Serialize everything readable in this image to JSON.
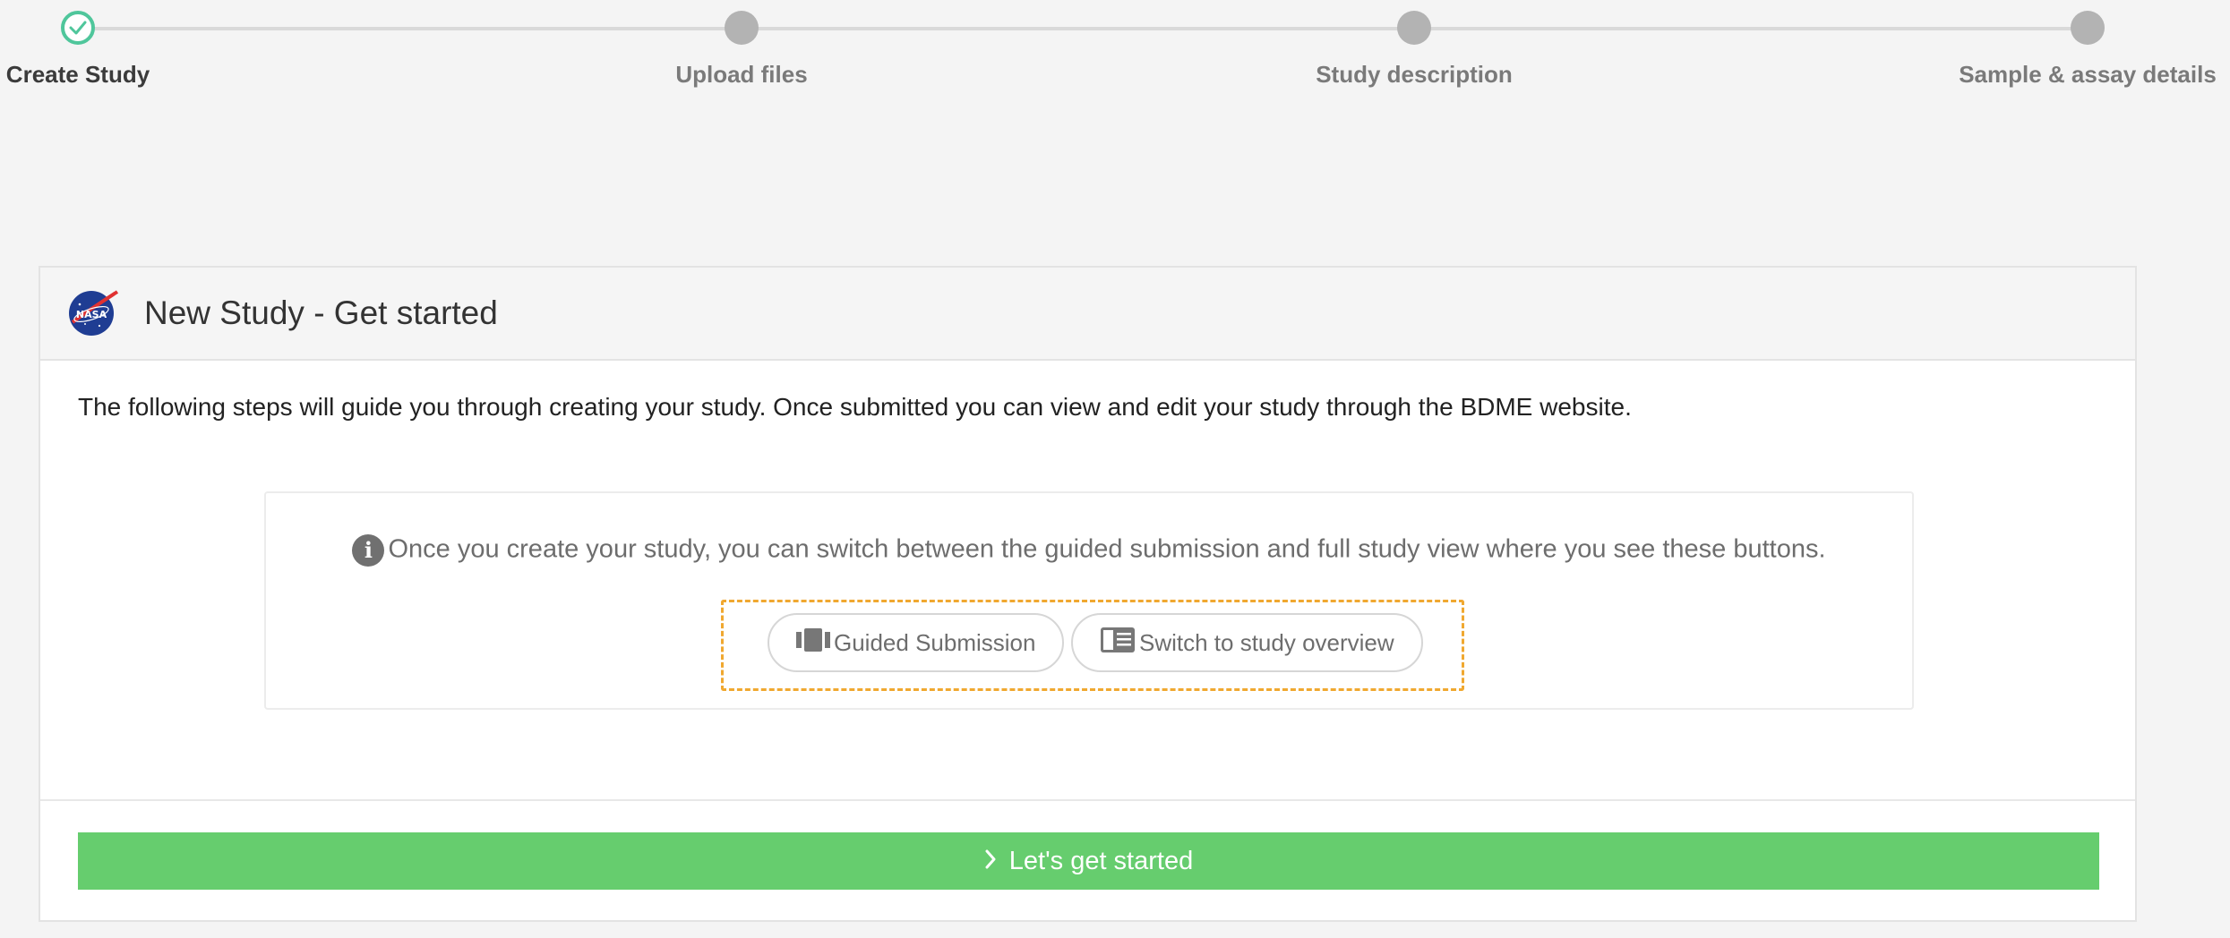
{
  "stepper": {
    "steps": [
      {
        "label": "Create Study",
        "status": "done"
      },
      {
        "label": "Upload files",
        "status": "pending"
      },
      {
        "label": "Study description",
        "status": "pending"
      },
      {
        "label": "Sample & assay details",
        "status": "pending"
      }
    ],
    "done_color": "#4fc69b",
    "pending_color": "#b3b3b3"
  },
  "panel": {
    "logo_icon": "nasa-logo-icon",
    "title": "New Study - Get started",
    "intro": "The following steps will guide you through creating your study. Once submitted you can view and edit your study through the BDME website.",
    "info": {
      "icon": "info-icon",
      "text": "Once you create your study, you can switch between the guided submission and full study view where you see these buttons."
    },
    "example_buttons": {
      "guided": {
        "label": "Guided Submission",
        "icon": "film-strip-icon"
      },
      "overview": {
        "label": "Switch to study overview",
        "icon": "sidebar-panel-icon"
      }
    },
    "highlight_color": "#f0a830",
    "start_button": {
      "label": "Let's get started",
      "icon": "chevron-right-icon",
      "color": "#66cd6e"
    }
  }
}
